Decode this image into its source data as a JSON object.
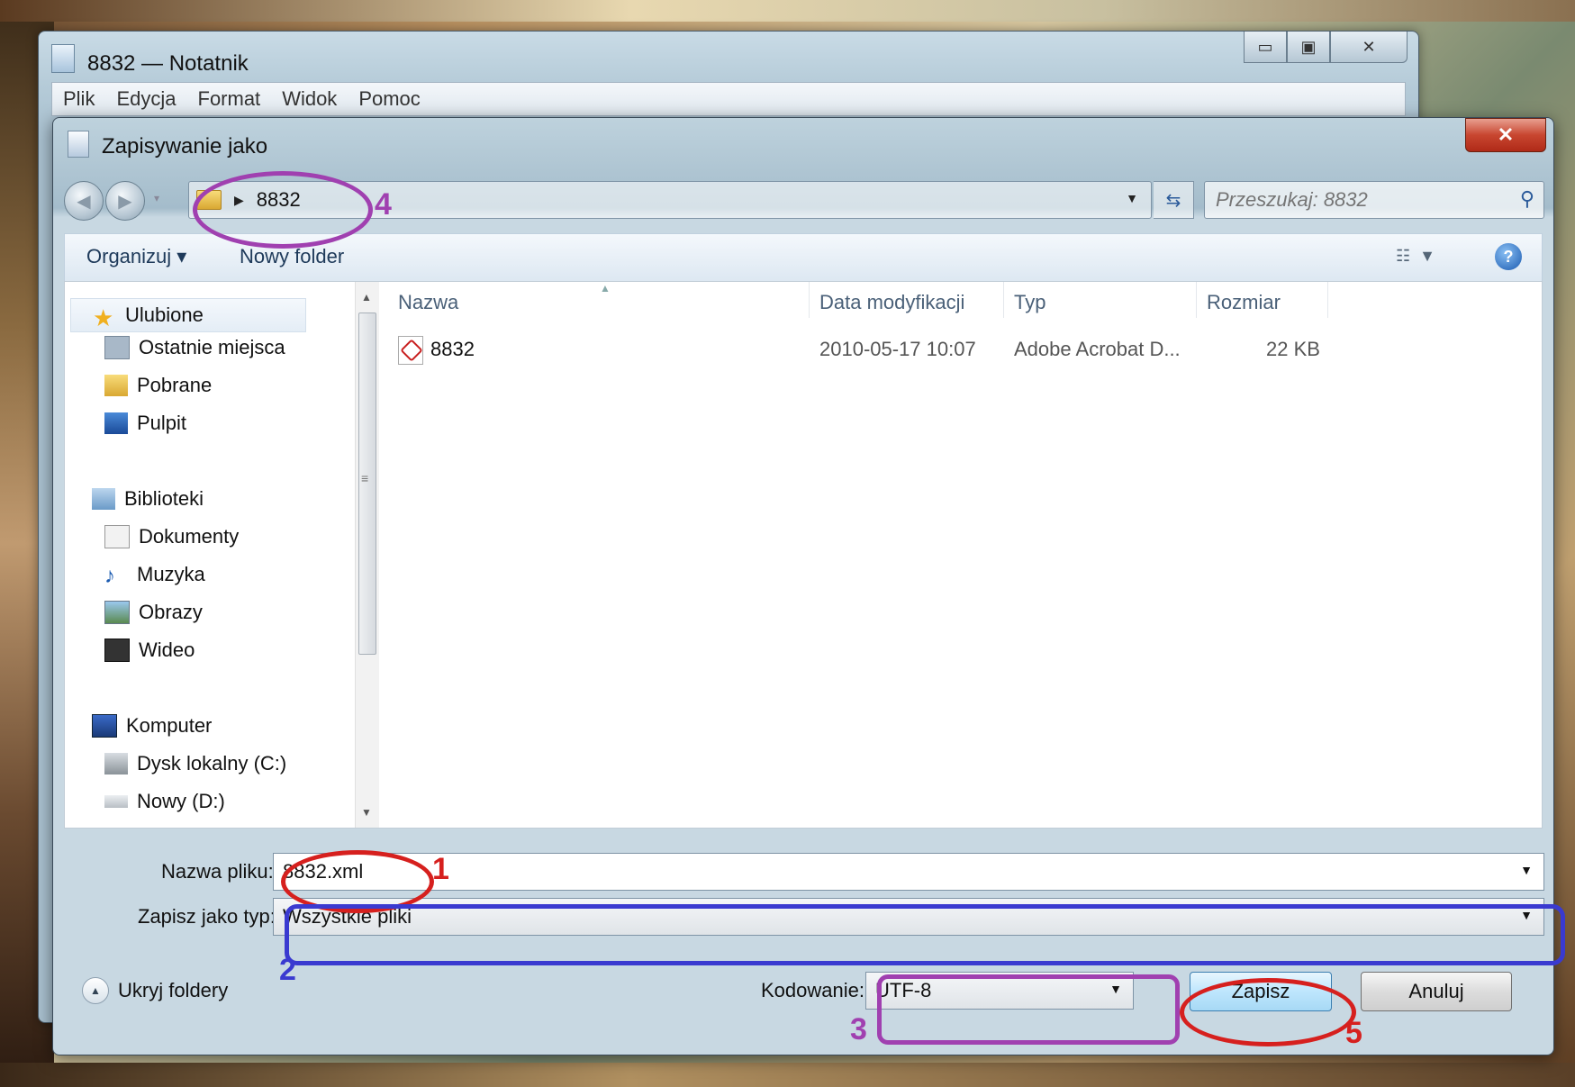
{
  "notepad": {
    "title": "8832 — Notatnik",
    "caption": {
      "minimize": "▭",
      "maximize": "▣",
      "close": "✕"
    },
    "menu": [
      "Plik",
      "Edycja",
      "Format",
      "Widok",
      "Pomoc"
    ]
  },
  "dialog": {
    "title": "Zapisywanie jako",
    "close": "✕",
    "address": {
      "crumb": "8832",
      "search_placeholder": "Przeszukaj: 8832"
    },
    "toolbar": {
      "organize": "Organizuj ▾",
      "new_folder": "Nowy folder",
      "help": "?"
    },
    "nav": {
      "favorites": {
        "label": "Ulubione",
        "items": [
          "Ostatnie miejsca",
          "Pobrane",
          "Pulpit"
        ]
      },
      "libraries": {
        "label": "Biblioteki",
        "items": [
          "Dokumenty",
          "Muzyka",
          "Obrazy",
          "Wideo"
        ]
      },
      "computer": {
        "label": "Komputer",
        "items": [
          "Dysk lokalny (C:)",
          "Nowy (D:)"
        ]
      }
    },
    "columns": [
      "Nazwa",
      "Data modyfikacji",
      "Typ",
      "Rozmiar"
    ],
    "files": [
      {
        "name": "8832",
        "modified": "2010-05-17 10:07",
        "type": "Adobe Acrobat D...",
        "size": "22 KB"
      }
    ],
    "form": {
      "filename_label": "Nazwa pliku:",
      "filename_value": "8832.xml",
      "filetype_label": "Zapisz jako typ:",
      "filetype_value": "Wszystkie pliki",
      "encoding_label": "Kodowanie:",
      "encoding_value": "UTF-8",
      "hide_folders": "Ukryj foldery",
      "save": "Zapisz",
      "cancel": "Anuluj"
    }
  },
  "annotations": {
    "colors": {
      "red": "#d6201e",
      "blue": "#3a3ad0",
      "purple": "#a040b0"
    },
    "numbers": [
      "1",
      "2",
      "3",
      "4",
      "5"
    ]
  }
}
